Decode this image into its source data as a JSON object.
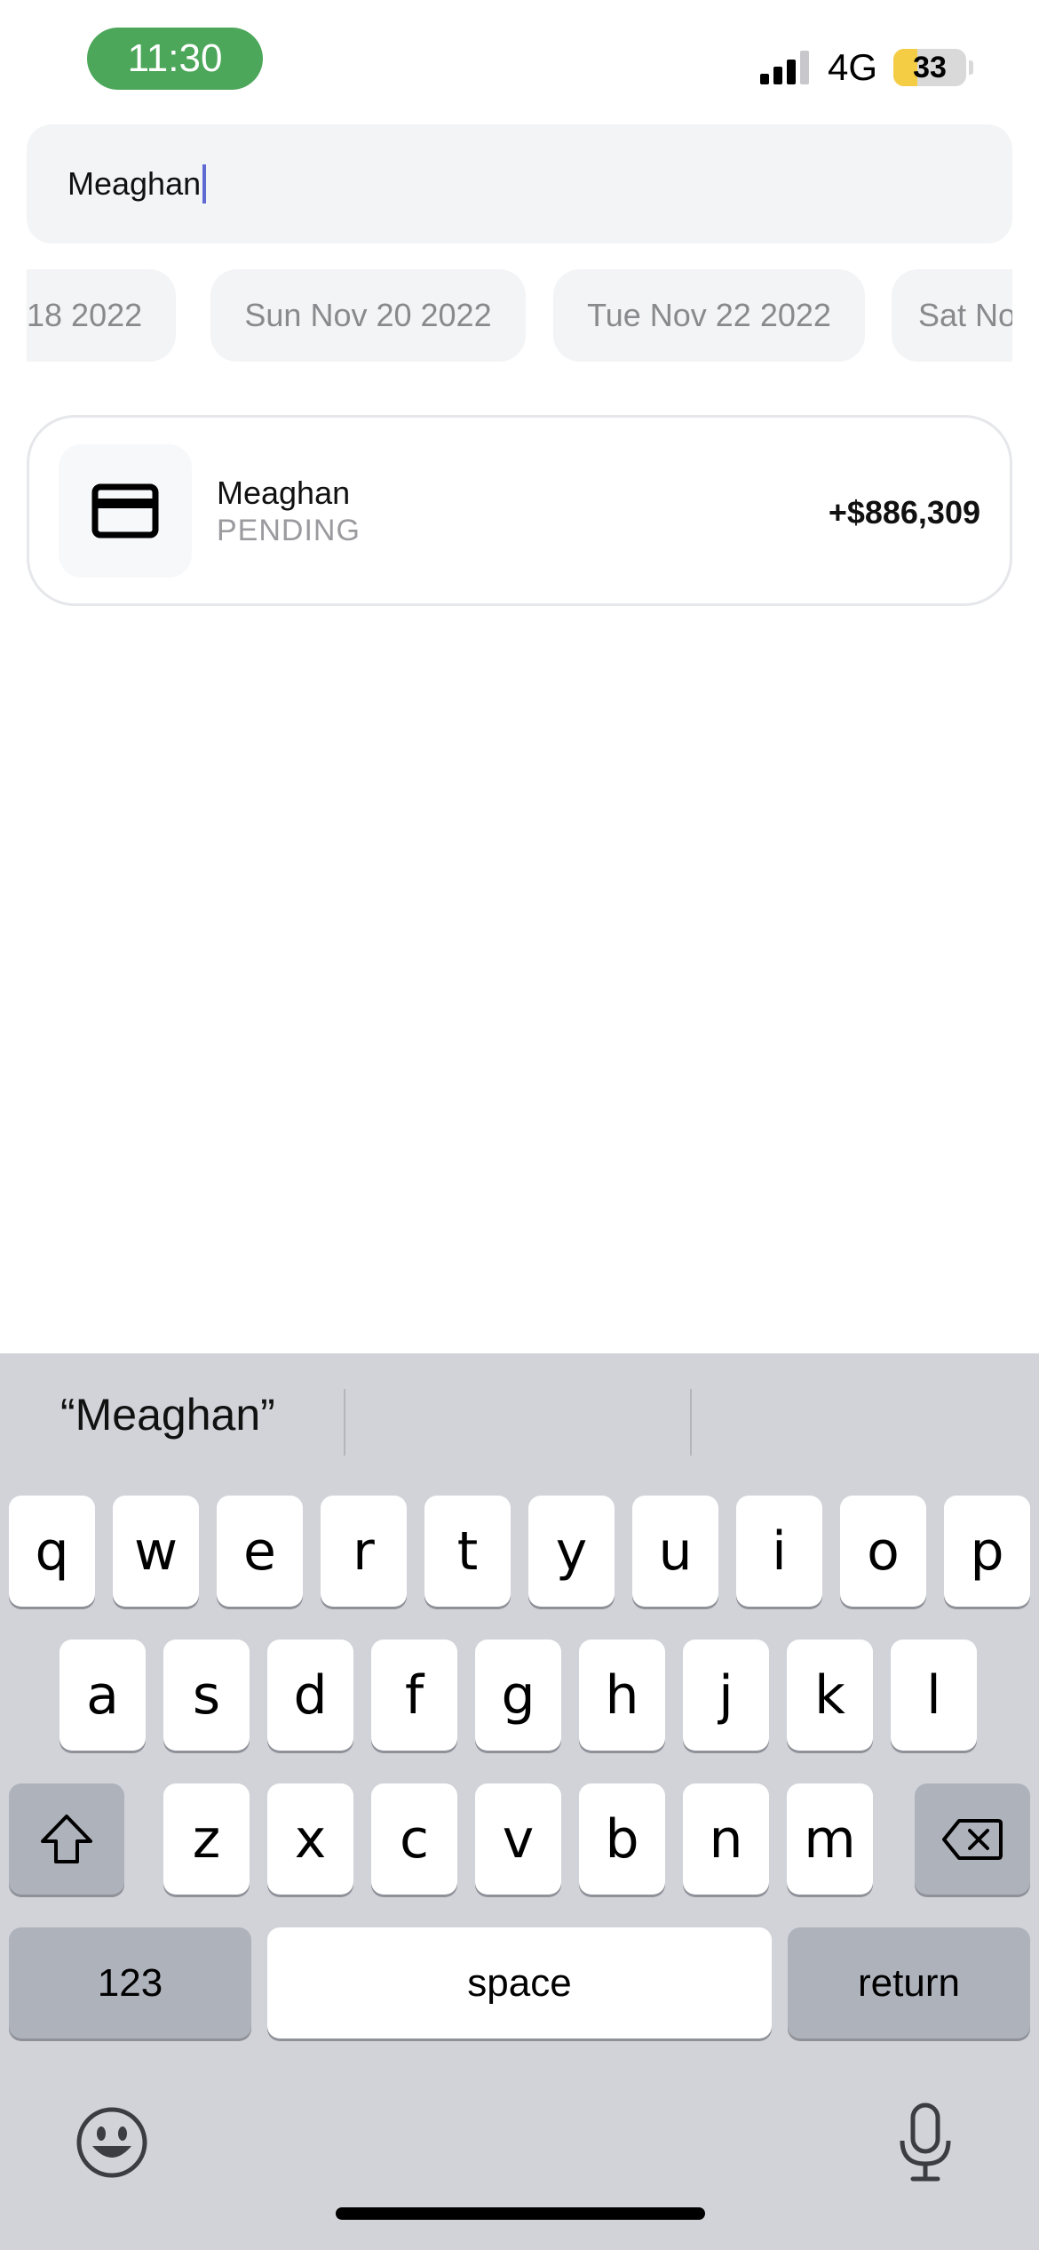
{
  "status_bar": {
    "time": "11:30",
    "network": "4G",
    "battery_level": "33",
    "battery_percent": 33,
    "time_pill_color": "#4da75a",
    "battery_color": "#f4cd44"
  },
  "search": {
    "value": "Meaghan"
  },
  "date_chips": [
    "18 2022",
    "Sun Nov 20 2022",
    "Tue Nov 22 2022",
    "Sat Nov"
  ],
  "transactions": [
    {
      "icon": "credit-card-icon",
      "name": "Meaghan",
      "status": "PENDING",
      "amount": "+$886,309"
    }
  ],
  "keyboard": {
    "suggestion": "“Meaghan”",
    "rows": [
      [
        "q",
        "w",
        "e",
        "r",
        "t",
        "y",
        "u",
        "i",
        "o",
        "p"
      ],
      [
        "a",
        "s",
        "d",
        "f",
        "g",
        "h",
        "j",
        "k",
        "l"
      ],
      [
        "z",
        "x",
        "c",
        "v",
        "b",
        "n",
        "m"
      ]
    ],
    "shift_icon": "shift-icon",
    "delete_icon": "delete-icon",
    "numbers_label": "123",
    "space_label": "space",
    "return_label": "return",
    "emoji_icon": "emoji-icon",
    "mic_icon": "microphone-icon"
  }
}
